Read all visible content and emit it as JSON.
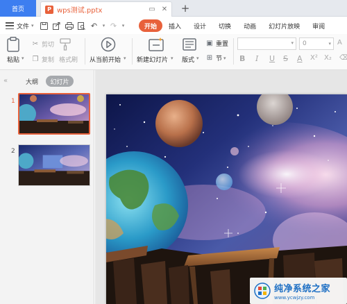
{
  "tabs": {
    "home": "首页",
    "document": "wps测试.pptx"
  },
  "menu": {
    "file": "文件",
    "tabs": [
      "开始",
      "插入",
      "设计",
      "切换",
      "动画",
      "幻灯片放映",
      "审阅"
    ],
    "active_tab": "开始"
  },
  "ribbon": {
    "paste": "粘贴",
    "cut": "剪切",
    "copy": "复制",
    "format_painter": "格式刷",
    "play_from_current": "从当前开始",
    "new_slide": "新建幻灯片",
    "layout": "版式",
    "reset": "重置",
    "section": "节",
    "font_size": "0",
    "format_buttons": [
      "B",
      "I",
      "U",
      "S",
      "A",
      "X²",
      "X₂"
    ]
  },
  "left_panel": {
    "outline": "大纲",
    "slides": "幻灯片",
    "slide_numbers": [
      "1",
      "2"
    ]
  },
  "watermark": {
    "title": "纯净系统之家",
    "url": "www.ycwjzy.com"
  },
  "colors": {
    "accent": "#e8613b",
    "home_tab": "#3d7ef0",
    "watermark": "#1d6fc4"
  }
}
